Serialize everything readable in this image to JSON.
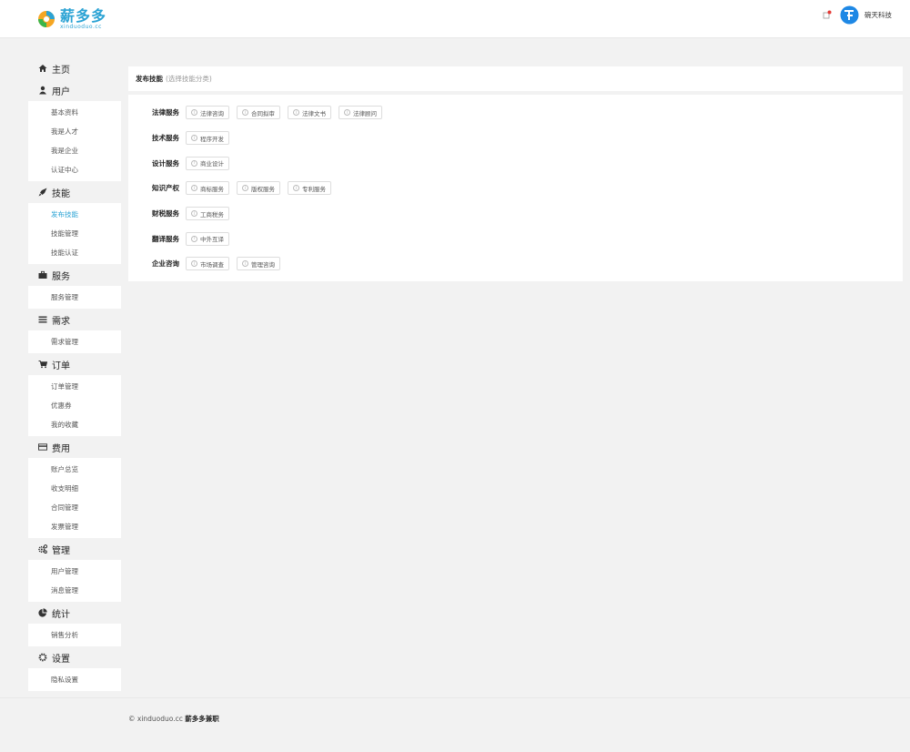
{
  "header": {
    "logo_title": "薪多多",
    "logo_sub": "xinduoduo.cc",
    "username": "碗天科技",
    "brand_color": "#2ba3d4"
  },
  "sidebar": {
    "groups": [
      {
        "label": "主页",
        "icon": "home-icon",
        "items": []
      },
      {
        "label": "用户",
        "icon": "user-icon",
        "items": [
          "基本资料",
          "我是人才",
          "我是企业",
          "认证中心"
        ]
      },
      {
        "label": "技能",
        "icon": "rocket-icon",
        "items": [
          "发布技能",
          "技能管理",
          "技能认证"
        ],
        "active": 0
      },
      {
        "label": "服务",
        "icon": "briefcase-icon",
        "items": [
          "服务管理"
        ]
      },
      {
        "label": "需求",
        "icon": "list-icon",
        "items": [
          "需求管理"
        ]
      },
      {
        "label": "订单",
        "icon": "cart-icon",
        "items": [
          "订单管理",
          "优惠券",
          "我的收藏"
        ]
      },
      {
        "label": "费用",
        "icon": "credit-card-icon",
        "items": [
          "账户总览",
          "收支明细",
          "合同管理",
          "发票管理"
        ]
      },
      {
        "label": "管理",
        "icon": "cogs-icon",
        "items": [
          "用户管理",
          "消息管理"
        ]
      },
      {
        "label": "统计",
        "icon": "pie-chart-icon",
        "items": [
          "销售分析"
        ]
      },
      {
        "label": "设置",
        "icon": "gear-icon",
        "items": [
          "隐私设置"
        ]
      }
    ]
  },
  "main": {
    "title": "发布技能",
    "hint": "(选择技能分类)",
    "categories": [
      {
        "label": "法律服务",
        "tags": [
          "法律咨询",
          "合同拟审",
          "法律文书",
          "法律顾问"
        ]
      },
      {
        "label": "技术服务",
        "tags": [
          "程序开发"
        ]
      },
      {
        "label": "设计服务",
        "tags": [
          "商业设计"
        ]
      },
      {
        "label": "知识产权",
        "tags": [
          "商标服务",
          "版权服务",
          "专利服务"
        ]
      },
      {
        "label": "财税服务",
        "tags": [
          "工商税务"
        ]
      },
      {
        "label": "翻译服务",
        "tags": [
          "中外互译"
        ]
      },
      {
        "label": "企业咨询",
        "tags": [
          "市场调查",
          "管理咨询"
        ]
      }
    ]
  },
  "footer": {
    "copyright": "© xinduoduo.cc",
    "brand": "薪多多兼职"
  }
}
